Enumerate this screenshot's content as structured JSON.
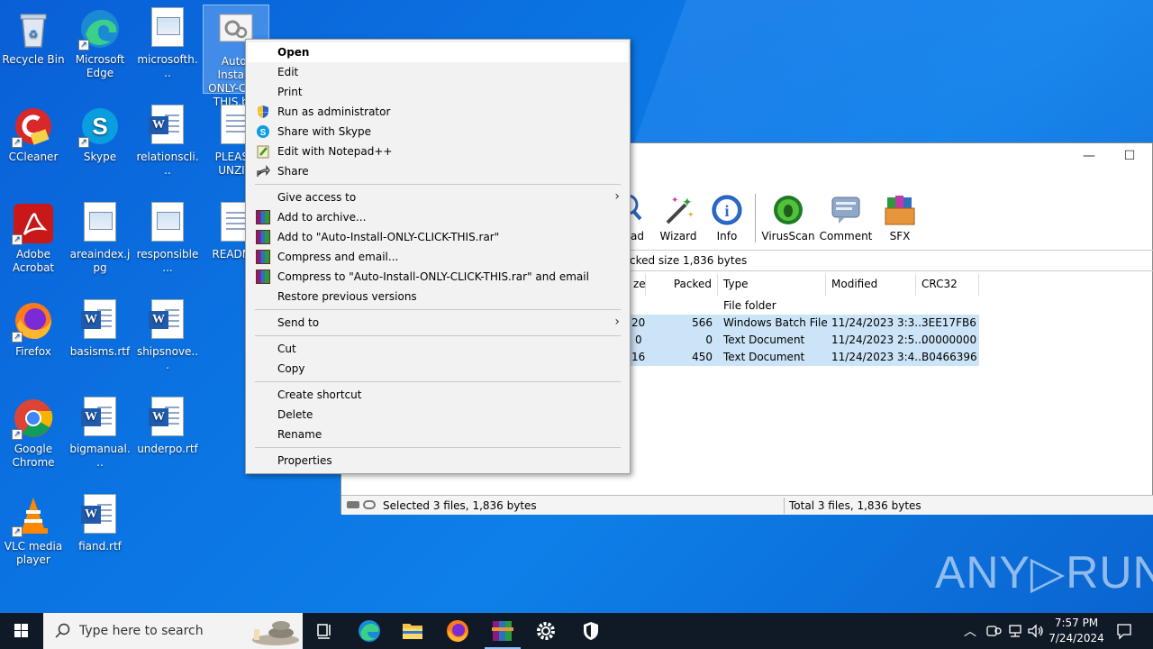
{
  "desktop": {
    "icons": [
      {
        "label": "Recycle Bin"
      },
      {
        "label": "Microsoft Edge"
      },
      {
        "label": "microsofth..."
      },
      {
        "label": "Auto-Insta... ONLY-C... -THIS.b..."
      },
      {
        "label": "CCleaner"
      },
      {
        "label": "Skype"
      },
      {
        "label": "relationscli..."
      },
      {
        "label": "PLEAS... UNZIP!"
      },
      {
        "label": "Adobe Acrobat"
      },
      {
        "label": "areaindex.jpg"
      },
      {
        "label": "responsible..."
      },
      {
        "label": "READM..."
      },
      {
        "label": "Firefox"
      },
      {
        "label": "basisms.rtf"
      },
      {
        "label": "shipsnove..."
      },
      {
        "label": "Google Chrome"
      },
      {
        "label": "bigmanual..."
      },
      {
        "label": "underpo.rtf"
      },
      {
        "label": "VLC media player"
      },
      {
        "label": "fiand.rtf"
      }
    ]
  },
  "winrar": {
    "toolbar": [
      {
        "label": "ad"
      },
      {
        "label": "Wizard"
      },
      {
        "label": "Info"
      },
      {
        "label": "VirusScan"
      },
      {
        "label": "Comment"
      },
      {
        "label": "SFX"
      }
    ],
    "path_text": "cked size 1,836 bytes",
    "columns": [
      "ze",
      "Packed",
      "Type",
      "Modified",
      "CRC32"
    ],
    "rows": [
      {
        "size": "",
        "packed": "",
        "type": "File folder",
        "modified": "",
        "crc": ""
      },
      {
        "size": "20",
        "packed": "566",
        "type": "Windows Batch File",
        "modified": "11/24/2023 3:3...",
        "crc": "3EE17FB6"
      },
      {
        "size": "0",
        "packed": "0",
        "type": "Text Document",
        "modified": "11/24/2023 2:5...",
        "crc": "00000000"
      },
      {
        "size": "16",
        "packed": "450",
        "type": "Text Document",
        "modified": "11/24/2023 3:4...",
        "crc": "B0466396"
      }
    ],
    "status_left": "Selected 3 files, 1,836 bytes",
    "status_right": "Total 3 files, 1,836 bytes",
    "minimize": "—",
    "maximize": "☐"
  },
  "context_menu": {
    "items": [
      {
        "label": "Open"
      },
      {
        "label": "Edit"
      },
      {
        "label": "Print"
      },
      {
        "label": "Run as administrator"
      },
      {
        "label": "Share with Skype"
      },
      {
        "label": "Edit with Notepad++"
      },
      {
        "label": "Share"
      },
      {
        "label": "Give access to"
      },
      {
        "label": "Add to archive..."
      },
      {
        "label": "Add to \"Auto-Install-ONLY-CLICK-THIS.rar\""
      },
      {
        "label": "Compress and email..."
      },
      {
        "label": "Compress to \"Auto-Install-ONLY-CLICK-THIS.rar\" and email"
      },
      {
        "label": "Restore previous versions"
      },
      {
        "label": "Send to"
      },
      {
        "label": "Cut"
      },
      {
        "label": "Copy"
      },
      {
        "label": "Create shortcut"
      },
      {
        "label": "Delete"
      },
      {
        "label": "Rename"
      },
      {
        "label": "Properties"
      }
    ]
  },
  "taskbar": {
    "search_placeholder": "Type here to search",
    "time": "7:57 PM",
    "date": "7/24/2024"
  },
  "watermark": "ANY▷RUN",
  "colors": {
    "desktop_blue": "#0b74e3",
    "taskbar": "#101a26",
    "menu_bg": "#f2f2f2",
    "selection": "#cce4f7"
  }
}
